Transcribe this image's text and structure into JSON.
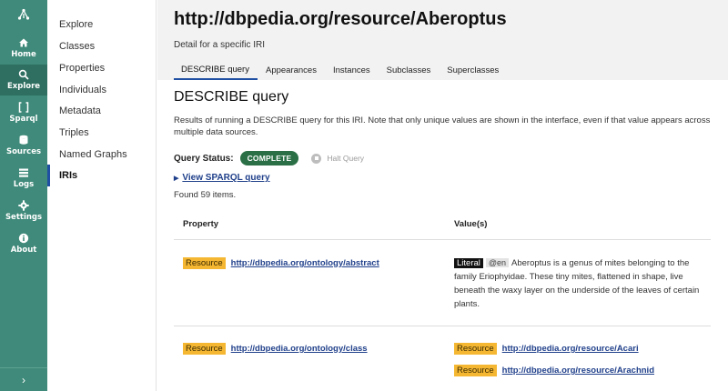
{
  "rail": {
    "items": [
      {
        "label": "Home",
        "icon": "home-icon"
      },
      {
        "label": "Explore",
        "icon": "search-icon"
      },
      {
        "label": "Sparql",
        "icon": "brackets-icon"
      },
      {
        "label": "Sources",
        "icon": "database-icon"
      },
      {
        "label": "Logs",
        "icon": "list-icon"
      },
      {
        "label": "Settings",
        "icon": "gear-icon"
      },
      {
        "label": "About",
        "icon": "info-icon"
      }
    ],
    "expand": "›",
    "active_color": "#2f6f61",
    "bg_color": "#3f8a7a"
  },
  "subnav": {
    "items": [
      "Explore",
      "Classes",
      "Properties",
      "Individuals",
      "Metadata",
      "Triples",
      "Named Graphs",
      "IRIs"
    ]
  },
  "header": {
    "title": "http://dbpedia.org/resource/Aberoptus",
    "subtitle": "Detail for a specific IRI",
    "tabs": [
      "DESCRIBE query",
      "Appearances",
      "Instances",
      "Subclasses",
      "Superclasses"
    ]
  },
  "content": {
    "section_title": "DESCRIBE query",
    "description": "Results of running a DESCRIBE query for this IRI. Note that only unique values are shown in the interface, even if that value appears across multiple data sources.",
    "query_status_label": "Query Status:",
    "query_status": "COMPLETE",
    "halt_label": "Halt Query",
    "view_sparql": "View SPARQL query",
    "found": "Found 59 items."
  },
  "table": {
    "headers": {
      "property": "Property",
      "values": "Value(s)"
    },
    "rows": [
      {
        "badge": "Resource",
        "property": "http://dbpedia.org/ontology/abstract",
        "value_badge": "Literal",
        "value_lang": "@en",
        "value_text": "Aberoptus is a genus of mites belonging to the family Eriophyidae. These tiny mites, flattened in shape, live beneath the waxy layer on the underside of the leaves of certain plants."
      },
      {
        "badge": "Resource",
        "property": "http://dbpedia.org/ontology/class",
        "values": [
          {
            "badge": "Resource",
            "link": "http://dbpedia.org/resource/Acari"
          },
          {
            "badge": "Resource",
            "link": "http://dbpedia.org/resource/Arachnid"
          }
        ]
      }
    ]
  }
}
